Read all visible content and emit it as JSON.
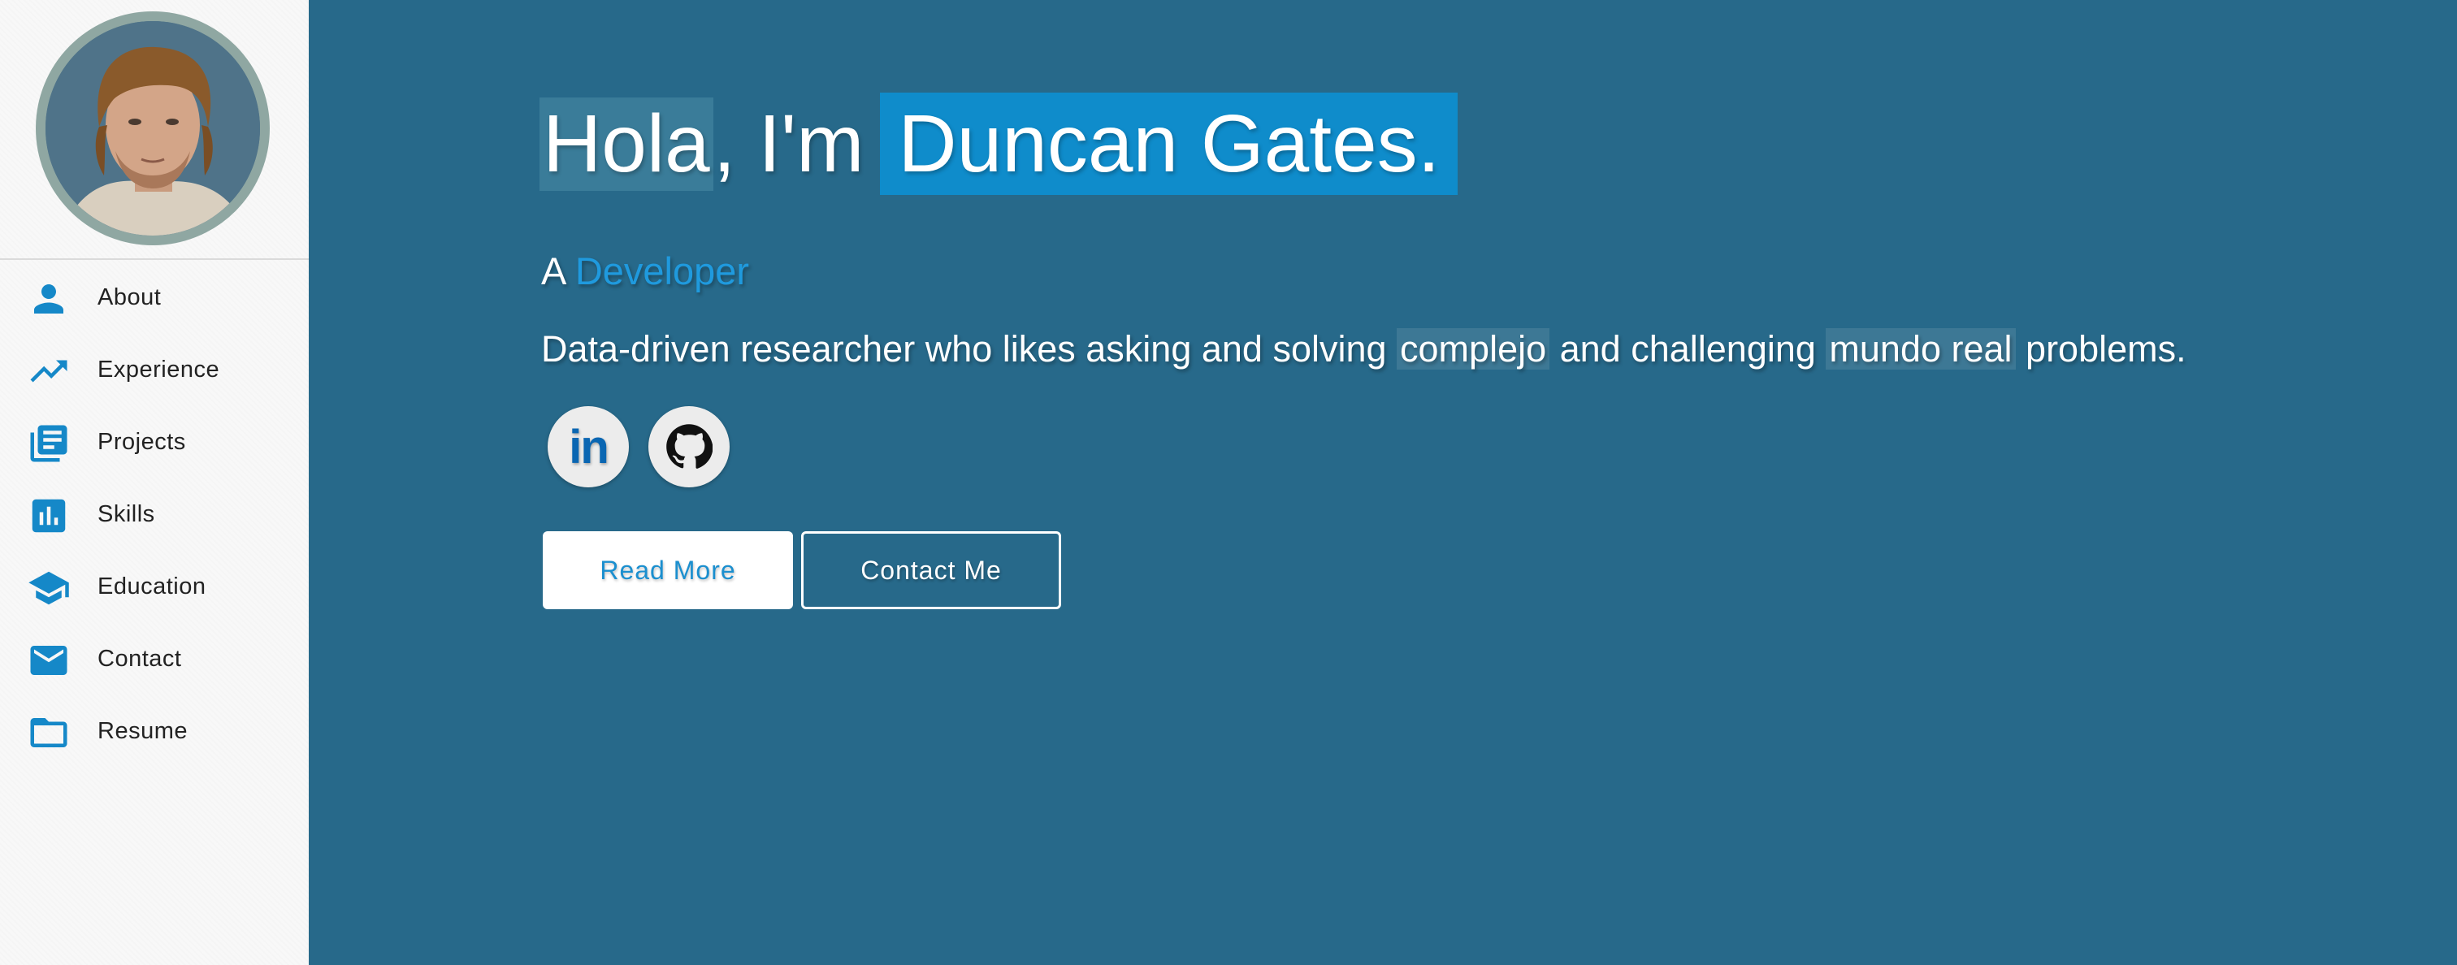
{
  "sidebar": {
    "items": [
      {
        "label": "About",
        "icon": "person-icon"
      },
      {
        "label": "Experience",
        "icon": "trending-up-icon"
      },
      {
        "label": "Projects",
        "icon": "library-books-icon"
      },
      {
        "label": "Skills",
        "icon": "bar-chart-icon"
      },
      {
        "label": "Education",
        "icon": "graduation-cap-icon"
      },
      {
        "label": "Contact",
        "icon": "mail-icon"
      },
      {
        "label": "Resume",
        "icon": "folder-icon"
      }
    ]
  },
  "hero": {
    "greeting_hola": "Hola",
    "greeting_rest": ", I'm",
    "name": "Duncan Gates.",
    "subtitle_prefix": "A",
    "role": "Developer",
    "desc_1": "Data-driven researcher who likes asking and solving ",
    "desc_hl1": "complejo",
    "desc_2": " and challenging ",
    "desc_hl2": "mundo real",
    "desc_3": " problems.",
    "social": [
      {
        "name": "linkedin-icon",
        "text": "in"
      },
      {
        "name": "github-icon"
      }
    ],
    "buttons": {
      "read_more": "Read More",
      "contact_me": "Contact Me"
    }
  },
  "colors": {
    "background": "#27698a",
    "accent": "#0f8ccb",
    "sidebar_icon": "#1588c8"
  }
}
